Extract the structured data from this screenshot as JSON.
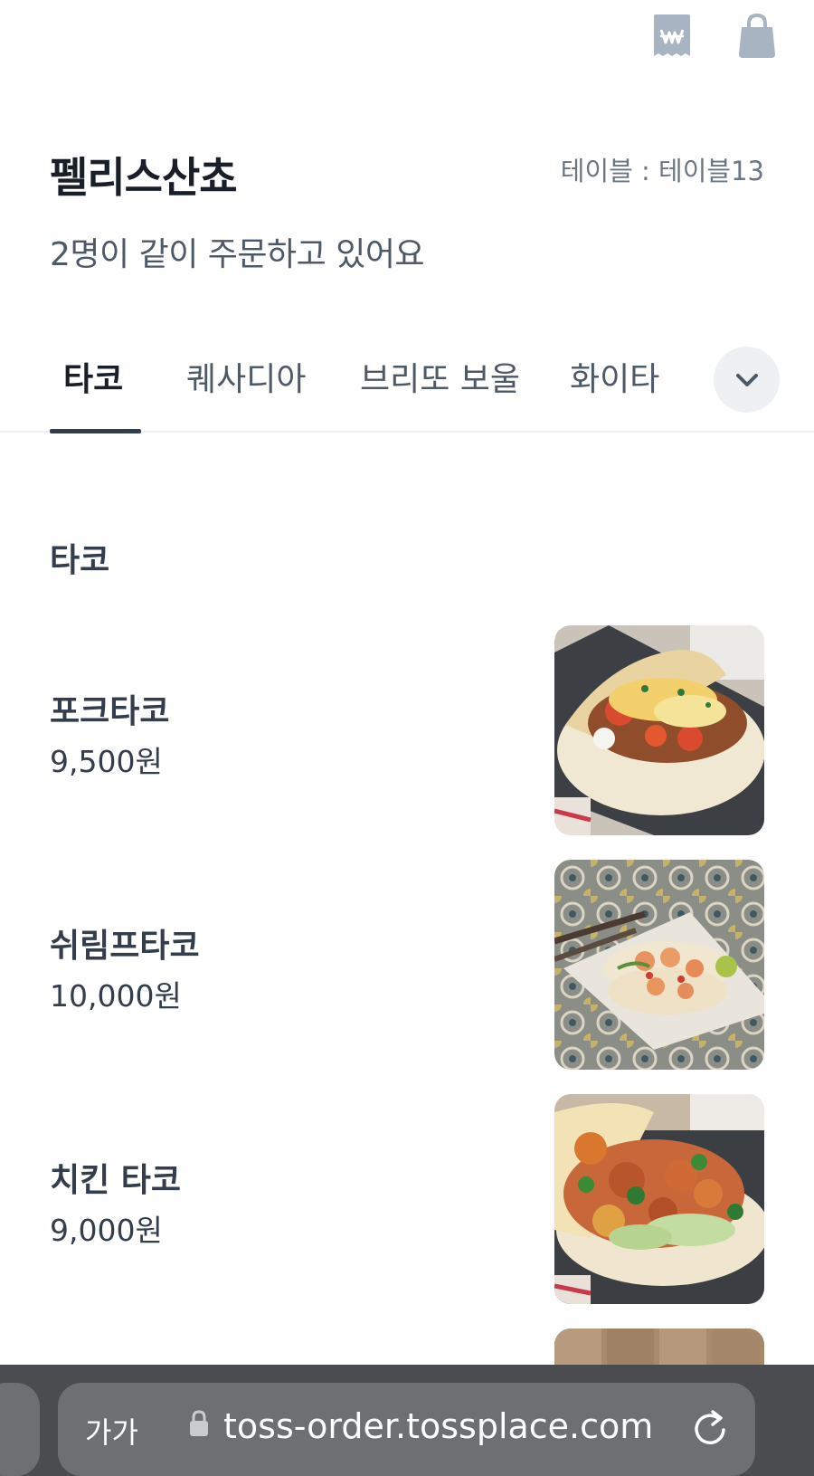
{
  "header": {
    "store_name": "펠리스산쵸",
    "table_info": "테이블 : 테이블13",
    "ordering_together": "2명이 같이 주문하고 있어요"
  },
  "icons": {
    "receipt": "won-receipt-icon",
    "cart": "shopping-bag-icon",
    "more_tabs": "chevron-down-icon",
    "lock": "lock-icon",
    "reload": "reload-icon"
  },
  "tabs": [
    {
      "label": "타코",
      "active": true
    },
    {
      "label": "퀘사디아",
      "active": false
    },
    {
      "label": "브리또 보울",
      "active": false
    },
    {
      "label": "화이타",
      "active": false
    }
  ],
  "section": {
    "title": "타코"
  },
  "menu": [
    {
      "name": "포크타코",
      "price": "9,500원"
    },
    {
      "name": "쉬림프타코",
      "price": "10,000원"
    },
    {
      "name": "치킨 타코",
      "price": "9,000원"
    }
  ],
  "browser": {
    "text_size_label": "가가",
    "url": "toss-order.tossplace.com"
  },
  "colors": {
    "text_primary": "#191f28",
    "text_secondary": "#4e5968",
    "text_muted": "#6b7684",
    "icon_gray": "#a9b4c2",
    "browser_bar": "#4a4c50"
  }
}
